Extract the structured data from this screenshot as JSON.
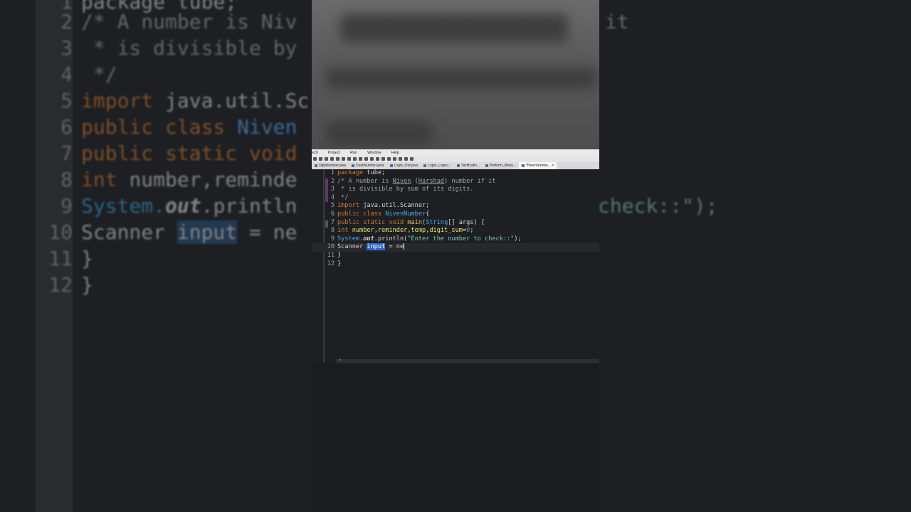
{
  "menu": [
    "ech",
    "Project",
    "Run",
    "Window",
    "Help"
  ],
  "tabs": [
    {
      "label": "UglyNumber.java",
      "active": false
    },
    {
      "label": "DuckNumber.java",
      "active": false
    },
    {
      "label": "Login_Out.java",
      "active": false
    },
    {
      "label": "Login_Logou...",
      "active": false
    },
    {
      "label": "Verificatio...",
      "active": false
    },
    {
      "label": "Perform_Mous...",
      "active": false
    },
    {
      "label": "*NivenNumbe...",
      "active": true,
      "close": "×"
    }
  ],
  "code": {
    "l1": {
      "n": "1",
      "kw": "package",
      "rest": " tube;"
    },
    "l2": {
      "n": "2",
      "a": "/* A number is ",
      "b": "Niven",
      "c": " (",
      "d": "Harshad",
      "e": ") number if it"
    },
    "l3": {
      "n": "3",
      "text": " * is divisible by sum of its digits."
    },
    "l4": {
      "n": "4",
      "text": " */"
    },
    "l5": {
      "n": "5",
      "kw": "import",
      "rest": " java.util.Scanner;"
    },
    "l6": {
      "n": "6",
      "kw": "public class",
      "cls": "NivenNumber",
      "rest": "{"
    },
    "l7": {
      "n": "7",
      "kw": "public static void",
      "m": "main(",
      "cls": "String",
      "rest": "[] args) {"
    },
    "l8": {
      "n": "8",
      "kw": "int",
      "rest": " number,reminder,temp,digit_sum=",
      "num": "0",
      "end": ";"
    },
    "l9": {
      "n": "9",
      "cls": "System",
      "dot": ".",
      "fld": "out",
      "m": ".println(",
      "str": "\"Enter the number to check::\"",
      "end": ");"
    },
    "l10": {
      "n": "10",
      "a": "Scanner ",
      "sel": "input",
      "b": " = ne"
    },
    "l11": {
      "n": "11",
      "text": "}"
    },
    "l12": {
      "n": "12",
      "text": "}"
    }
  },
  "bg": {
    "line1": {
      "n": "1",
      "text": "package tube;"
    },
    "line2": {
      "n": "2",
      "text": "/* A number is Niv"
    },
    "line3": {
      "n": "3",
      "text": " * is divisible by"
    },
    "line4": {
      "n": "4",
      "text": " */"
    },
    "line5": {
      "n": "5",
      "kw": "import",
      "rest": " java.util.Sc"
    },
    "line6": {
      "n": "6",
      "kw": "public class",
      "cls": " Niven"
    },
    "line7": {
      "n": "7",
      "kw": "public static void"
    },
    "line8": {
      "n": "8",
      "kw": "int",
      "rest": " number,reminde"
    },
    "line9": {
      "n": "9",
      "sys": "System.",
      "fld": "out",
      "rest": ".println"
    },
    "line10": {
      "n": "10",
      "a": "Scanner ",
      "hl": "input",
      "b": " = ne"
    },
    "line11": {
      "n": "11",
      "text": "}"
    },
    "line12": {
      "n": "12",
      "text": "}"
    },
    "right1": "it",
    "right9": "check::\");"
  },
  "scroll_arrow": "‹"
}
